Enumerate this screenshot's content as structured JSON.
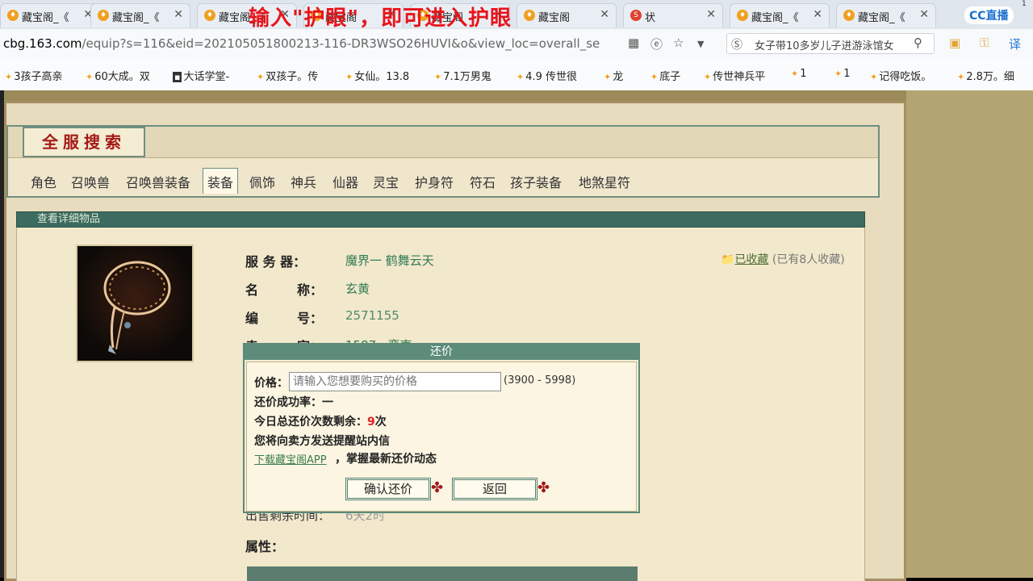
{
  "browser": {
    "tabs": [
      {
        "title": "藏宝阁_《",
        "icon": "cbg-favicon"
      },
      {
        "title": "藏宝阁_《",
        "icon": "cbg-favicon"
      },
      {
        "title": "藏宝阁_《",
        "icon": "cbg-favicon"
      },
      {
        "title": "藏宝阁",
        "icon": "cbg-favicon"
      },
      {
        "title": "藏宝阁",
        "icon": "cbg-favicon"
      },
      {
        "title": "藏宝阁",
        "icon": "cbg-favicon"
      },
      {
        "title": "状",
        "icon": "s-favicon"
      },
      {
        "title": "藏宝阁_《",
        "icon": "cbg-favicon"
      },
      {
        "title": "藏宝阁_《",
        "icon": "cbg-favicon"
      }
    ],
    "tab_close": "✕",
    "overlay_text": "输入\"护眼\"，即可进入护眼",
    "stream_logo": "CC直播",
    "stream_badge": "1",
    "url_domain": "cbg.163.com",
    "url_rest": "/equip?s=116&eid=202105051800213-116-DR3WSO26HUVI&o&view_loc=overall_se",
    "search_text": "女子带10多岁儿子进游泳馆女",
    "bookmarks": [
      "3孩子高亲",
      "60大成。双",
      "大话学堂-",
      "双孩子。传",
      "女仙。13.8",
      "7.1万男鬼",
      "4.9 传世很",
      "龙",
      "底子",
      "传世神兵平",
      "1",
      "1",
      "记得吃饭。",
      "2.8万。细"
    ]
  },
  "search_panel": {
    "logo_text": "全服搜索",
    "nav_tabs": [
      "角色",
      "召唤兽",
      "召唤兽装备",
      "装备",
      "佩饰",
      "神兵",
      "仙器",
      "灵宝",
      "护身符",
      "符石",
      "孩子装备",
      "地煞星符"
    ],
    "active_tab": "装备"
  },
  "detail": {
    "header": "查看详细物品",
    "fields": [
      {
        "label": "服 务 器：",
        "value": "魔界一 鹤舞云天"
      },
      {
        "label": "名　　　称：",
        "value": "玄黄"
      },
      {
        "label": "编　　　号：",
        "value": "2571155"
      },
      {
        "label": "卖　　　家：",
        "value": "1587 · 蛮夷"
      }
    ],
    "fav_label": "已收藏",
    "fav_count": "(已有8人收藏)",
    "hidden_row_label": "出售剩余时间：",
    "hidden_row_value": "6天2时",
    "attr_label": "属性："
  },
  "modal": {
    "title": "还价",
    "price_label": "价格：",
    "price_placeholder": "请输入您想要购买的价格",
    "price_range": "(3900 - 5998)",
    "success_rate_label": "还价成功率：一",
    "remain_prefix": "今日总还价次数剩余：",
    "remain_count": "9",
    "remain_suffix": "次",
    "notice": "您将向卖方发送提醒站内信",
    "app_link": "下载藏宝阁APP",
    "app_desc": "，掌握最新还价动态",
    "confirm_button": "确认还价",
    "back_button": "返回"
  }
}
